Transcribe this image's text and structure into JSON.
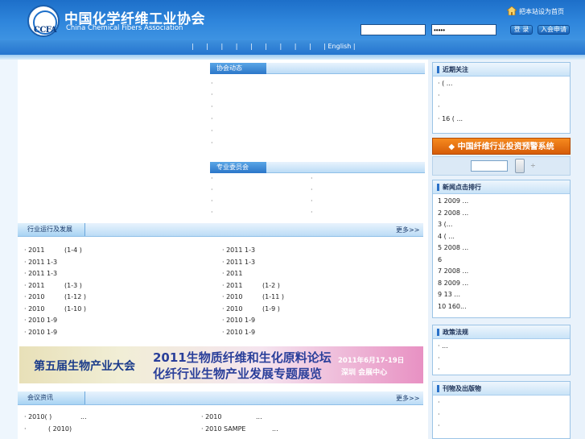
{
  "header": {
    "title_cn": "中国化学纤维工业协会",
    "title_en": "China Chemical Fibers Association",
    "logo_text": "CCFA",
    "homepage_link": "把本站设为首页",
    "username_value": "",
    "password_value": "•••••",
    "login_label": "登 录",
    "join_label": "入会申请"
  },
  "nav": {
    "items": [
      "|",
      "|",
      "|",
      "|",
      "|",
      "|",
      "|",
      "|",
      "|",
      "| English |"
    ]
  },
  "association_news": {
    "tab": "协会动态",
    "lines": [
      "·",
      "·",
      "·",
      "·",
      "·",
      "·"
    ]
  },
  "committees": {
    "tab": "专业委员会",
    "left_lines": [
      "·",
      "·",
      "·",
      "·"
    ],
    "right_lines": [
      "·",
      "·",
      "·",
      "·"
    ]
  },
  "industry": {
    "tab": "行业运行及发展",
    "more": "更多>>",
    "left_rows": [
      {
        "a": "· 2011",
        "b": "(1-4 )"
      },
      {
        "a": "· 2011 1-3",
        "b": ""
      },
      {
        "a": "· 2011 1-3",
        "b": ""
      },
      {
        "a": "· 2011",
        "b": "(1-3 )"
      },
      {
        "a": "· 2010",
        "b": "(1-12 )"
      },
      {
        "a": "· 2010",
        "b": "(1-10 )"
      },
      {
        "a": "· 2010 1-9",
        "b": ""
      },
      {
        "a": "· 2010 1-9",
        "b": ""
      }
    ],
    "right_rows": [
      {
        "a": "· 2011 1-3",
        "b": ""
      },
      {
        "a": "· 2011 1-3",
        "b": ""
      },
      {
        "a": "· 2011",
        "b": ""
      },
      {
        "a": "· 2011",
        "b": "(1-2 )"
      },
      {
        "a": "· 2010",
        "b": "(1-11 )"
      },
      {
        "a": "· 2010",
        "b": "(1-9 )"
      },
      {
        "a": "· 2010 1-9",
        "b": ""
      },
      {
        "a": "· 2010 1-9",
        "b": ""
      }
    ]
  },
  "banner": {
    "left_text": "第五届生物产业大会",
    "title_top": "2011生物质纤维和生化原料论坛",
    "title_bottom": "化纤行业生物产业发展专题展览",
    "date": "2011年6月17-19日",
    "location": "深圳   会展中心"
  },
  "meetings": {
    "tab": "会议资讯",
    "more": "更多>>",
    "left_rows": [
      {
        "a": "· 2010(  )",
        "b": "..."
      },
      {
        "a": "·",
        "b": "( 2010)"
      }
    ],
    "right_rows": [
      {
        "a": "· 2010",
        "b": "..."
      },
      {
        "a": "· 2010 SAMPE",
        "b": "..."
      }
    ]
  },
  "sidebar": {
    "recent_focus": {
      "title": "近期关注",
      "rows": [
        "·        ( ...",
        "·",
        "·",
        "· 16      ( ..."
      ]
    },
    "warning_system": "中国纤维行业投资预警系统",
    "search_go": "÷",
    "news_rank": {
      "title": "新闻点击排行",
      "rows": [
        "1 2009        ...",
        "2 2008        ...",
        "3         (...",
        "4         ( ...",
        "5 2008        ...",
        "6",
        "7 2008        ...",
        "8 2009        ...",
        "9     13       ...",
        "10        160..."
      ]
    },
    "policy": {
      "title": "政策法规",
      "rows": [
        "·            ...",
        "·",
        "·"
      ]
    },
    "publications": {
      "title": "刊物及出版物",
      "rows": [
        "·",
        "·",
        "·"
      ]
    }
  },
  "colors": {
    "header_blue": "#2f86dc",
    "nav_blue": "#2575cf",
    "warning_orange": "#e8720f"
  }
}
